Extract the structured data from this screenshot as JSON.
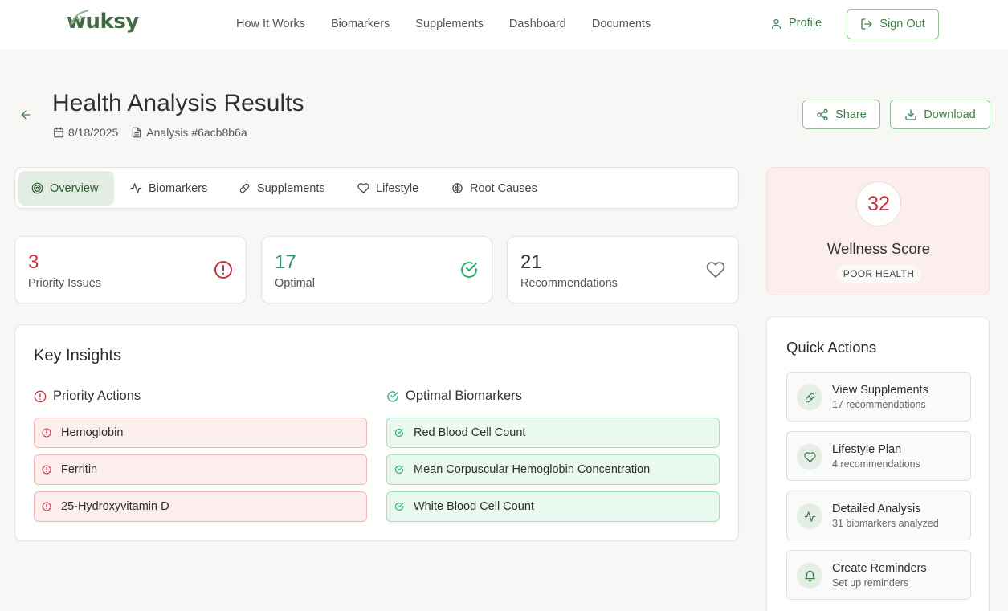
{
  "header": {
    "brand": "wuksy",
    "nav": [
      "How It Works",
      "Biomarkers",
      "Supplements",
      "Dashboard",
      "Documents"
    ],
    "profile_label": "Profile",
    "signout_label": "Sign Out"
  },
  "page": {
    "title": "Health Analysis Results",
    "date": "8/18/2025",
    "analysis_id": "Analysis #6acb8b6a",
    "share_label": "Share",
    "download_label": "Download"
  },
  "tabs": [
    {
      "label": "Overview",
      "icon": "target-icon",
      "active": true
    },
    {
      "label": "Biomarkers",
      "icon": "activity-icon",
      "active": false
    },
    {
      "label": "Supplements",
      "icon": "pill-icon",
      "active": false
    },
    {
      "label": "Lifestyle",
      "icon": "heart-icon",
      "active": false
    },
    {
      "label": "Root Causes",
      "icon": "brain-icon",
      "active": false
    }
  ],
  "stats": [
    {
      "value": "3",
      "label": "Priority Issues",
      "color": "#c7343f",
      "icon": "alert-circle-icon"
    },
    {
      "value": "17",
      "label": "Optimal",
      "color": "#2f8f6a",
      "icon": "check-circle-icon"
    },
    {
      "value": "21",
      "label": "Recommendations",
      "color": "#333333",
      "icon": "heart-icon"
    }
  ],
  "insights": {
    "title": "Key Insights",
    "priority": {
      "heading": "Priority Actions",
      "items": [
        "Hemoglobin",
        "Ferritin",
        "25-Hydroxyvitamin D"
      ]
    },
    "optimal": {
      "heading": "Optimal Biomarkers",
      "items": [
        "Red Blood Cell Count",
        "Mean Corpuscular Hemoglobin Concentration",
        "White Blood Cell Count"
      ]
    }
  },
  "score": {
    "value": "32",
    "title": "Wellness Score",
    "badge": "POOR HEALTH"
  },
  "quick_actions": {
    "title": "Quick Actions",
    "items": [
      {
        "title": "View Supplements",
        "subtitle": "17 recommendations",
        "icon": "pill-icon"
      },
      {
        "title": "Lifestyle Plan",
        "subtitle": "4 recommendations",
        "icon": "heart-icon"
      },
      {
        "title": "Detailed Analysis",
        "subtitle": "31 biomarkers analyzed",
        "icon": "activity-icon"
      },
      {
        "title": "Create Reminders",
        "subtitle": "Set up reminders",
        "icon": "bell-icon"
      }
    ]
  },
  "colors": {
    "brand_green": "#3f7e4a",
    "alert_red": "#c7343f",
    "optimal_green": "#2f8f6a"
  }
}
